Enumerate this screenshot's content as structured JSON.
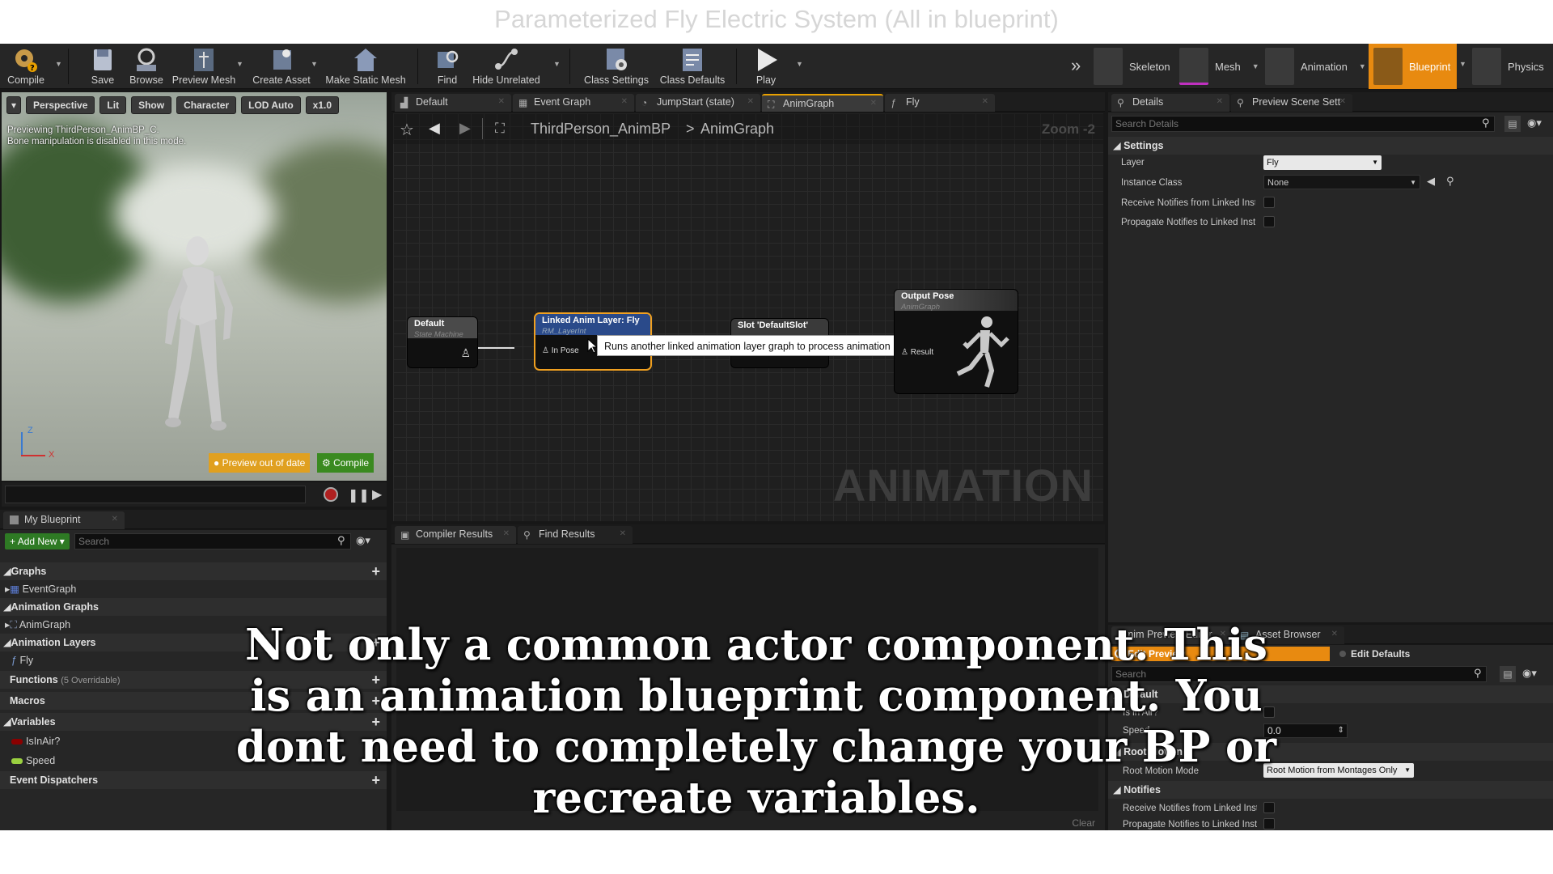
{
  "video_title": "Parameterized Fly Electric System  (All in blueprint)",
  "toolbar": {
    "items": [
      "Compile",
      "Save",
      "Browse",
      "Preview Mesh",
      "Create Asset",
      "Make Static Mesh",
      "Find",
      "Hide Unrelated",
      "Class Settings",
      "Class Defaults",
      "Play"
    ],
    "modes": [
      "Skeleton",
      "Mesh",
      "Animation",
      "Blueprint",
      "Physics"
    ],
    "expand_glyph": "»"
  },
  "viewport": {
    "buttons": [
      "Perspective",
      "Lit",
      "Show",
      "Character",
      "LOD Auto",
      "x1.0"
    ],
    "note_line1": "Previewing ThirdPerson_AnimBP_C.",
    "note_line2": "Bone manipulation is disabled in this mode.",
    "preview_badge": "Preview out of date",
    "compile_badge": "Compile",
    "axis_z": "Z",
    "axis_x": "X"
  },
  "my_blueprint": {
    "tab": "My Blueprint",
    "add_new": "Add New",
    "search_placeholder": "Search",
    "graphs_header": "Graphs",
    "event_graph": "EventGraph",
    "anim_graphs_header": "Animation Graphs",
    "anim_graph": "AnimGraph",
    "anim_layers_header": "Animation Layers",
    "fly_layer": "Fly",
    "functions_header": "Functions",
    "functions_count": "(5 Overridable)",
    "macros_header": "Macros",
    "variables_header": "Variables",
    "var1": "IsInAir?",
    "var2": "Speed",
    "dispatchers_header": "Event Dispatchers"
  },
  "graph_tabs": [
    "Default",
    "Event Graph",
    "JumpStart (state)",
    "AnimGraph",
    "Fly"
  ],
  "graph": {
    "breadcrumb_root": "ThirdPerson_AnimBP",
    "breadcrumb_sep": ">",
    "breadcrumb_leaf": "AnimGraph",
    "zoom": "Zoom -2",
    "watermark": "ANIMATION",
    "node_default_title": "Default",
    "node_default_sub": "State Machine",
    "node_layer_title": "Linked Anim Layer: Fly",
    "node_layer_sub": "RM_LayerInt",
    "node_layer_pin": "In Pose",
    "node_slot_title": "Slot 'DefaultSlot'",
    "node_output_title": "Output Pose",
    "node_output_sub": "AnimGraph",
    "node_output_pin": "Result",
    "tooltip": "Runs another linked animation layer graph to process animation"
  },
  "bottom_tabs": [
    "Compiler Results",
    "Find Results"
  ],
  "clear_label": "Clear",
  "details": {
    "tab": "Details",
    "tab2": "Preview Scene Sett",
    "search_placeholder": "Search Details",
    "settings_header": "Settings",
    "layer_label": "Layer",
    "layer_value": "Fly",
    "instance_label": "Instance Class",
    "instance_value": "None",
    "receive_label": "Receive Notifies from Linked Insta",
    "propagate_label": "Propagate Notifies to Linked Insta"
  },
  "anim_preview": {
    "tab": "Anim Preview Editor",
    "tab2": "Asset Browser",
    "edit_preview": "Edit Preview",
    "edit_defaults": "Edit Defaults",
    "search_placeholder": "Search",
    "default_header": "Default",
    "is_in_air": "Is in Air?",
    "speed_label": "Speed",
    "speed_value": "0.0",
    "root_motion_header": "Root Motion",
    "root_motion_label": "Root Motion Mode",
    "root_motion_value": "Root Motion from Montages Only",
    "notifies_header": "Notifies",
    "receive_label": "Receive Notifies from Linked Inst",
    "propagate_label": "Propagate Notifies to Linked Insta"
  },
  "caption": {
    "line1": "Not only a common actor component. This",
    "line2": "is an animation blueprint component. You",
    "line3": "dont need to completely change your BP or",
    "line4": "recreate variables."
  },
  "colors": {
    "accent_orange": "#f0a020",
    "compile_green": "#3a8a20",
    "add_new_green": "#3a7a2a",
    "bool_var": "#8a0000",
    "float_var": "#9ad040"
  }
}
